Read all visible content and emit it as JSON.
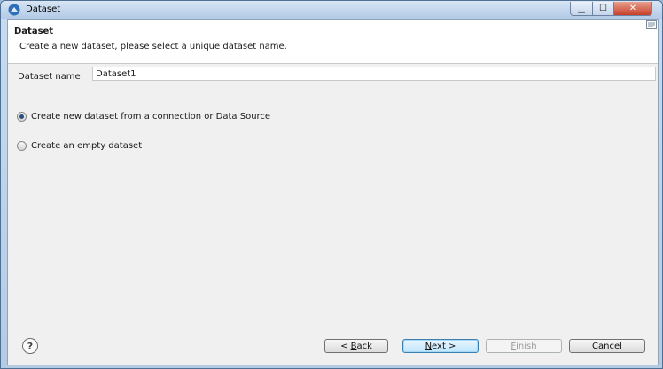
{
  "window": {
    "title": "Dataset",
    "close_glyph": "✕",
    "minimize_glyph": "▁",
    "maximize_glyph": "☐"
  },
  "header": {
    "title": "Dataset",
    "description": "Create a new dataset, please select a unique dataset name."
  },
  "form": {
    "name_label": "Dataset name:",
    "name_value": "Dataset1"
  },
  "options": [
    {
      "label": "Create new dataset from a connection or Data Source",
      "selected": true
    },
    {
      "label": "Create an empty dataset",
      "selected": false
    }
  ],
  "footer": {
    "help_glyph": "?",
    "back": {
      "prefix": "< ",
      "mnemonic": "B",
      "rest": "ack"
    },
    "next": {
      "mnemonic": "N",
      "rest": "ext >"
    },
    "finish": {
      "mnemonic": "F",
      "rest": "inish",
      "enabled": false
    },
    "cancel": "Cancel"
  },
  "colors": {
    "titlebar": "#c4d7ee",
    "client_bg": "#f0f0f0",
    "close_button": "#c7402b",
    "default_button_border": "#3c7fb1"
  }
}
